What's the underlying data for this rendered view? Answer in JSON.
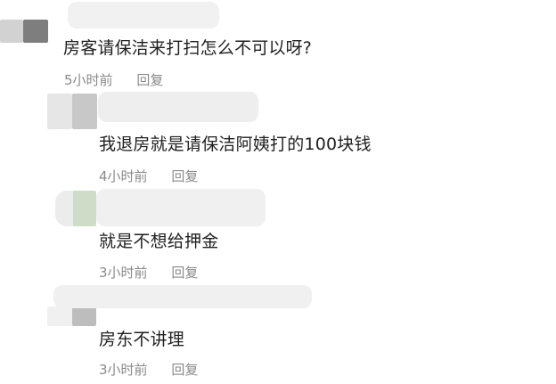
{
  "comments": [
    {
      "text": "房客请保洁来打扫怎么不可以呀?",
      "time": "5小时前",
      "reply": "回复"
    },
    {
      "text": "我退房就是请保洁阿姨打的100块钱",
      "time": "4小时前",
      "reply": "回复"
    },
    {
      "text": "就是不想给押金",
      "time": "3小时前",
      "reply": "回复"
    },
    {
      "text": "房东不讲理",
      "time": "3小时前",
      "reply": "回复"
    }
  ]
}
